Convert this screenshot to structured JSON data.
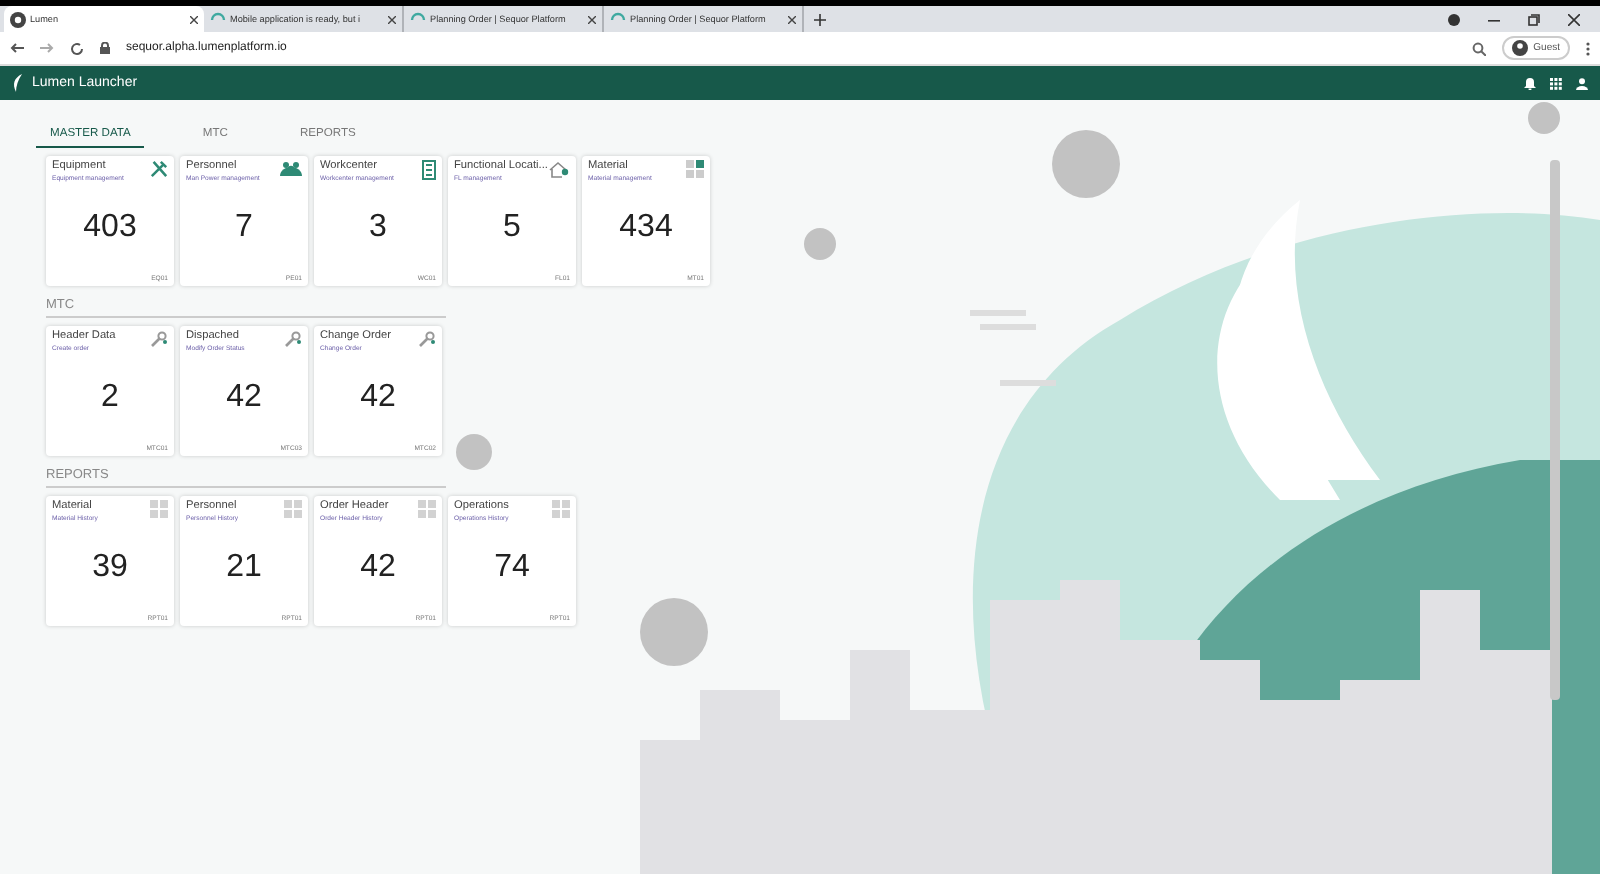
{
  "browser": {
    "tabs": [
      {
        "title": "Lumen",
        "selected": true,
        "kind": "app"
      },
      {
        "title": "Mobile application is ready, but i",
        "selected": false,
        "kind": "spinner"
      },
      {
        "title": "Planning Order | Sequor Platform",
        "selected": false,
        "kind": "spinner"
      },
      {
        "title": "Planning Order | Sequor Platform",
        "selected": false,
        "kind": "spinner"
      }
    ],
    "url": "sequor.alpha.lumenplatform.io",
    "profile": "Guest"
  },
  "app": {
    "title": "Lumen Launcher"
  },
  "tabs": [
    {
      "label": "MASTER DATA",
      "selected": true
    },
    {
      "label": "MTC",
      "selected": false
    },
    {
      "label": "REPORTS",
      "selected": false
    }
  ],
  "sections": [
    {
      "tiles": [
        {
          "title": "Equipment",
          "subtitle": "Equipment management",
          "count": "403",
          "code": "EQ01",
          "kind": "tools"
        },
        {
          "title": "Personnel",
          "subtitle": "Man Power management",
          "count": "7",
          "code": "PE01",
          "kind": "people"
        },
        {
          "title": "Workcenter",
          "subtitle": "Workcenter management",
          "count": "3",
          "code": "WC01",
          "kind": "building"
        },
        {
          "title": "Functional Locati...",
          "subtitle": "FL management",
          "count": "5",
          "code": "FL01",
          "kind": "location"
        },
        {
          "title": "Material",
          "subtitle": "Material management",
          "count": "434",
          "code": "MT01",
          "kind": "grid"
        }
      ]
    },
    {
      "title": "MTC",
      "tiles": [
        {
          "title": "Header Data",
          "subtitle": "Create order",
          "count": "2",
          "code": "MTC01",
          "kind": "wrench"
        },
        {
          "title": "Dispached",
          "subtitle": "Modify Order Status",
          "count": "42",
          "code": "MTC03",
          "kind": "wrench"
        },
        {
          "title": "Change Order",
          "subtitle": "Change Order",
          "count": "42",
          "code": "MTC02",
          "kind": "wrench"
        }
      ]
    },
    {
      "title": "REPORTS",
      "tiles": [
        {
          "title": "Material",
          "subtitle": "Material History",
          "count": "39",
          "code": "RPT01",
          "kind": "grid-grey"
        },
        {
          "title": "Personnel",
          "subtitle": "Personnel History",
          "count": "21",
          "code": "RPT01",
          "kind": "grid-grey"
        },
        {
          "title": "Order Header",
          "subtitle": "Order Header History",
          "count": "42",
          "code": "RPT01",
          "kind": "grid-grey"
        },
        {
          "title": "Operations",
          "subtitle": "Operations History",
          "count": "74",
          "code": "RPT01",
          "kind": "grid-grey"
        }
      ]
    }
  ]
}
